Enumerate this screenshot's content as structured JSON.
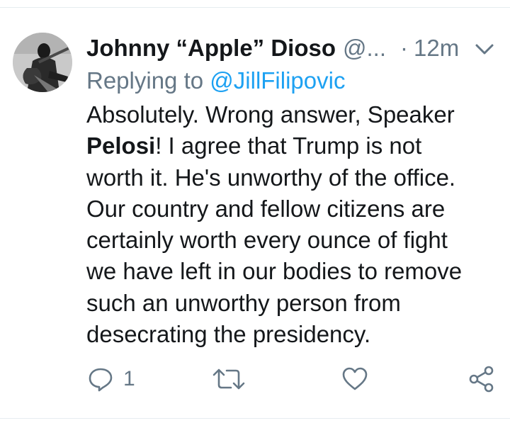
{
  "tweet": {
    "author_name": "Johnny “Apple” Dioso",
    "author_handle": "@...",
    "separator": "·",
    "timestamp": "12m",
    "replying_prefix": "Replying to",
    "replying_to": "@JillFilipovic",
    "text_lines": [
      "Absolutely. Wrong answer, Speaker",
      "Pelosi",
      "! I agree that Trump is not",
      "worth it. He's unworthy of the office.",
      "Our country and fellow citizens are",
      "certainly worth every ounce of fight",
      "we have left in our bodies to remove",
      "such an unworthy person from",
      "desecrating the presidency."
    ]
  },
  "actions": {
    "reply_count": "1",
    "icons": [
      "reply-icon",
      "retweet-icon",
      "like-icon",
      "share-icon"
    ]
  },
  "colors": {
    "text": "#14171a",
    "secondary": "#657786",
    "link": "#1da1f2",
    "divider": "#e6ecf0"
  }
}
